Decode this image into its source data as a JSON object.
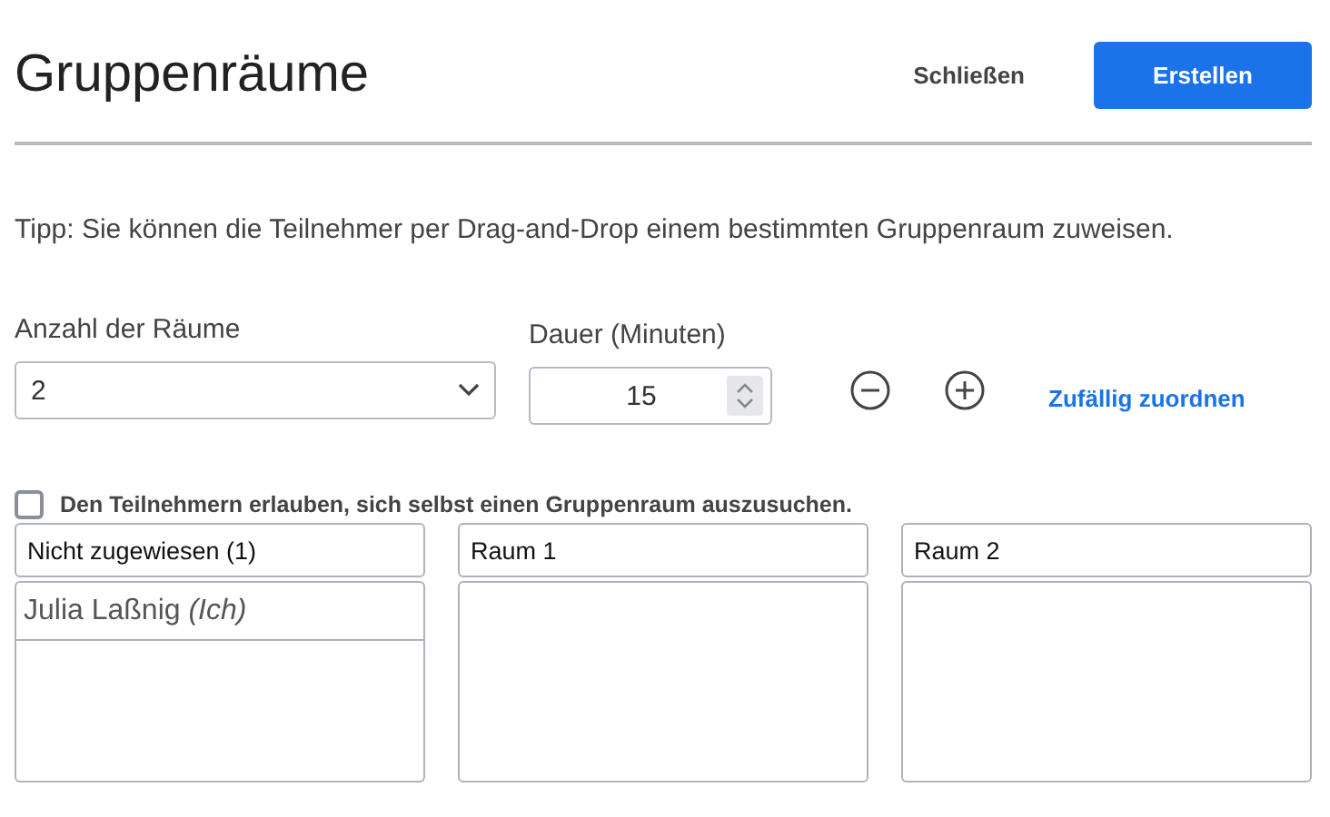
{
  "header": {
    "title": "Gruppenräume",
    "close_label": "Schließen",
    "create_label": "Erstellen"
  },
  "tip": "Tipp: Sie können die Teilnehmer per Drag-and-Drop einem bestimmten Gruppenraum zuweisen.",
  "rooms_count": {
    "label": "Anzahl der Räume",
    "value": "2"
  },
  "duration": {
    "label": "Dauer (Minuten)",
    "value": "15"
  },
  "random_assign": "Zufällig zuordnen",
  "self_select": {
    "label": "Den Teilnehmern erlauben, sich selbst einen Gruppenraum auszusuchen.",
    "checked": false
  },
  "rooms": [
    {
      "name": "Nicht zugewiesen (1)",
      "participants": [
        "Julia Laßnig *(Ich)*"
      ]
    },
    {
      "name": "Raum 1"
    },
    {
      "name": "Raum 2"
    }
  ]
}
